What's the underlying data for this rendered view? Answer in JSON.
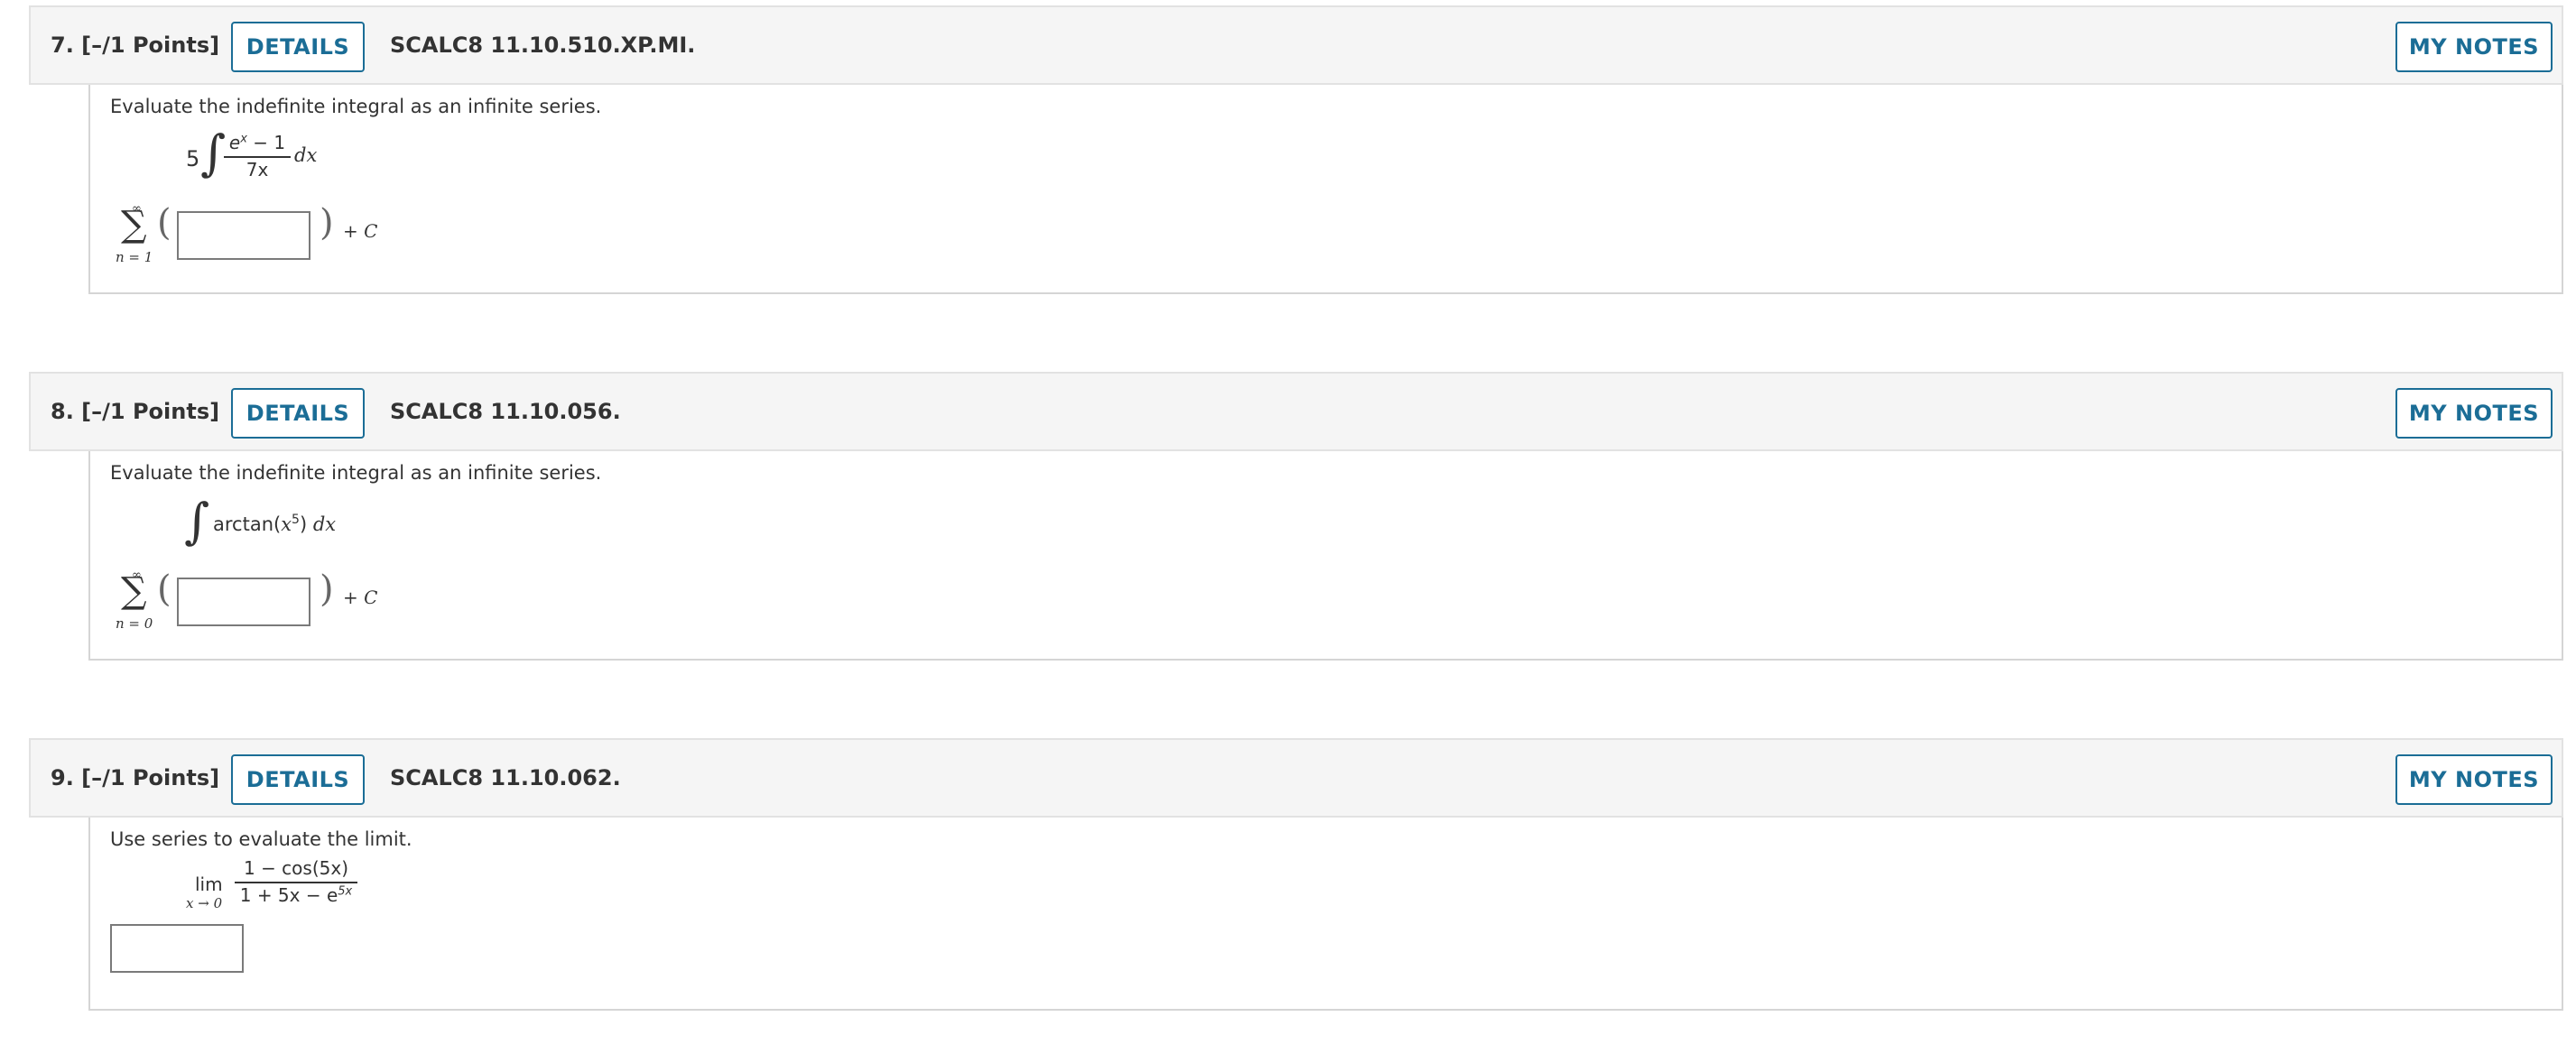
{
  "questions": [
    {
      "number_label": "7.  [–/1 Points]",
      "details_label": "DETAILS",
      "code": "SCALC8 11.10.510.XP.MI.",
      "notes_label": "MY NOTES",
      "prompt": "Evaluate the indefinite integral as an infinite series.",
      "integral": {
        "coefficient": "5",
        "integral_sign": "∫",
        "numerator_base": "e",
        "numerator_exp": "x",
        "numerator_rest": " − 1",
        "denominator": "7x",
        "differential": "dx"
      },
      "series": {
        "upper": "∞",
        "sigma": "∑",
        "lower": "n = 1",
        "open_paren": "(",
        "close_paren": ")",
        "suffix": "+ C",
        "answer_value": ""
      }
    },
    {
      "number_label": "8.  [–/1 Points]",
      "details_label": "DETAILS",
      "code": "SCALC8 11.10.056.",
      "notes_label": "MY NOTES",
      "prompt": "Evaluate the indefinite integral as an infinite series.",
      "integral": {
        "integral_sign": "∫",
        "func": "arctan(",
        "base": "x",
        "exp": "5",
        "close": ")",
        "differential": "dx"
      },
      "series": {
        "upper": "∞",
        "sigma": "∑",
        "lower": "n = 0",
        "open_paren": "(",
        "close_paren": ")",
        "suffix": "+ C",
        "answer_value": ""
      }
    },
    {
      "number_label": "9.  [–/1 Points]",
      "details_label": "DETAILS",
      "code": "SCALC8 11.10.062.",
      "notes_label": "MY NOTES",
      "prompt": "Use series to evaluate the limit.",
      "limit": {
        "lim": "lim",
        "sub": "x → 0",
        "numerator": "1 − cos(5x)",
        "denominator_base": "1 + 5x − e",
        "denominator_exp": "5x"
      },
      "answer_value": ""
    }
  ]
}
